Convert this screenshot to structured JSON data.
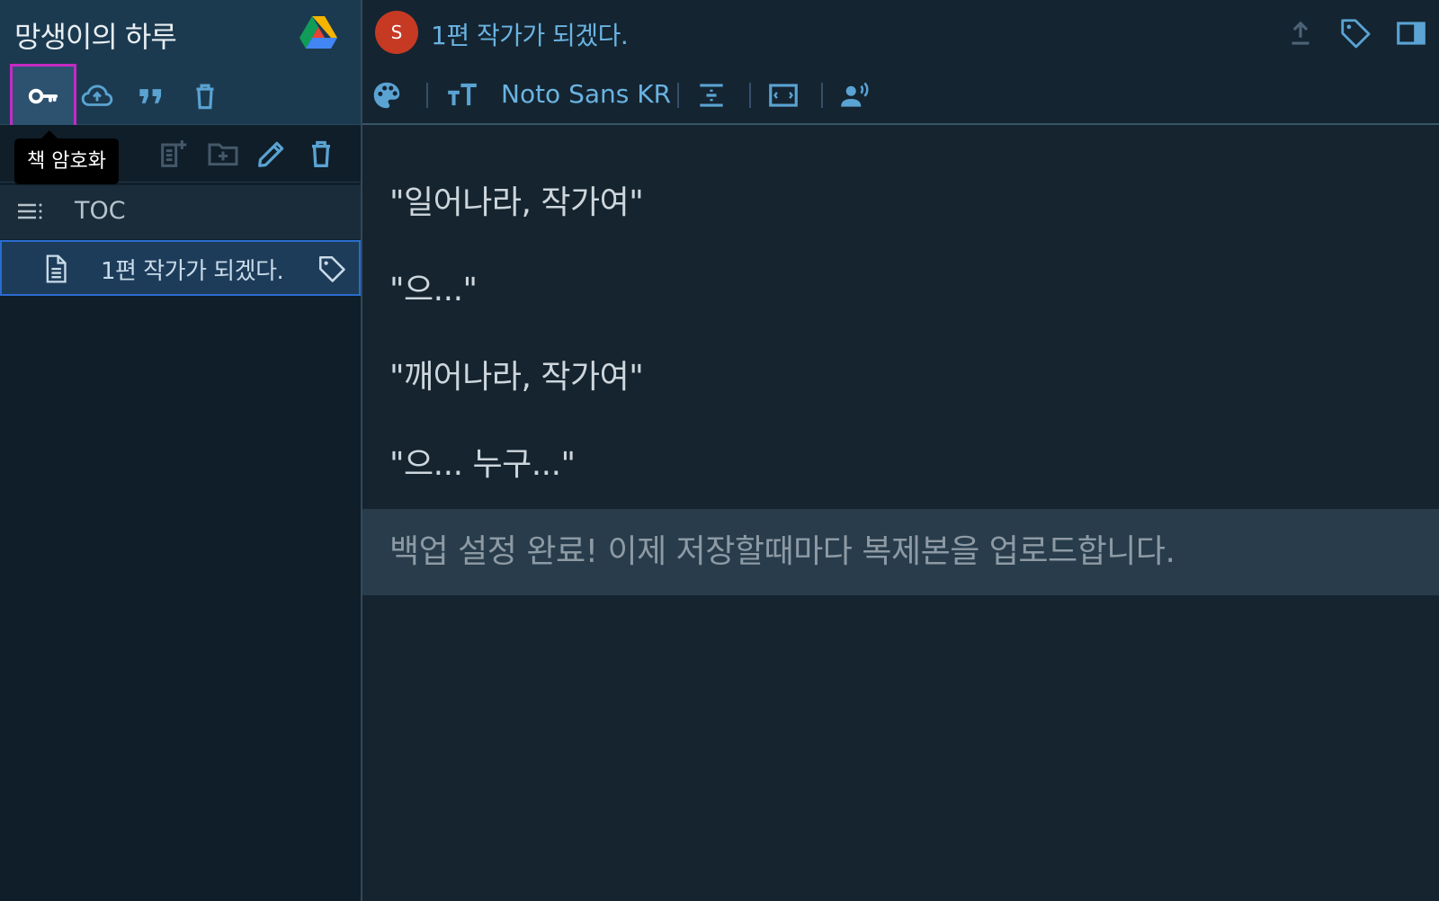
{
  "sidebar": {
    "book_title": "망생이의 하루",
    "book_tools": [
      {
        "name": "encrypt-book",
        "icon": "key-icon",
        "active": true
      },
      {
        "name": "backup",
        "icon": "cloud-upload-icon"
      },
      {
        "name": "quotes",
        "icon": "quote-icon"
      },
      {
        "name": "delete-book",
        "icon": "trash-icon"
      }
    ],
    "tooltip": "책 암호화",
    "toc_label": "TOC",
    "chapter": {
      "label": "1편 작가가 되겠다."
    }
  },
  "header": {
    "avatar_letter": "S",
    "doc_title": "1편 작가가 되겠다.",
    "font_name": "Noto Sans KR"
  },
  "content": {
    "paragraphs": [
      "\"일어나라, 작가여\"",
      "\"으...\"",
      "\"깨어나라, 작가여\"",
      "\"으... 누구...\""
    ],
    "notice": "백업 설정 완료! 이제 저장할때마다 복제본을 업로드합니다."
  },
  "colors": {
    "accent": "#6ab3e1",
    "sidebar_header": "#1c3a4f",
    "selection_border": "#2a6ccf",
    "tooltip_highlight": "#c42ac4",
    "avatar_bg": "#c63a24"
  }
}
